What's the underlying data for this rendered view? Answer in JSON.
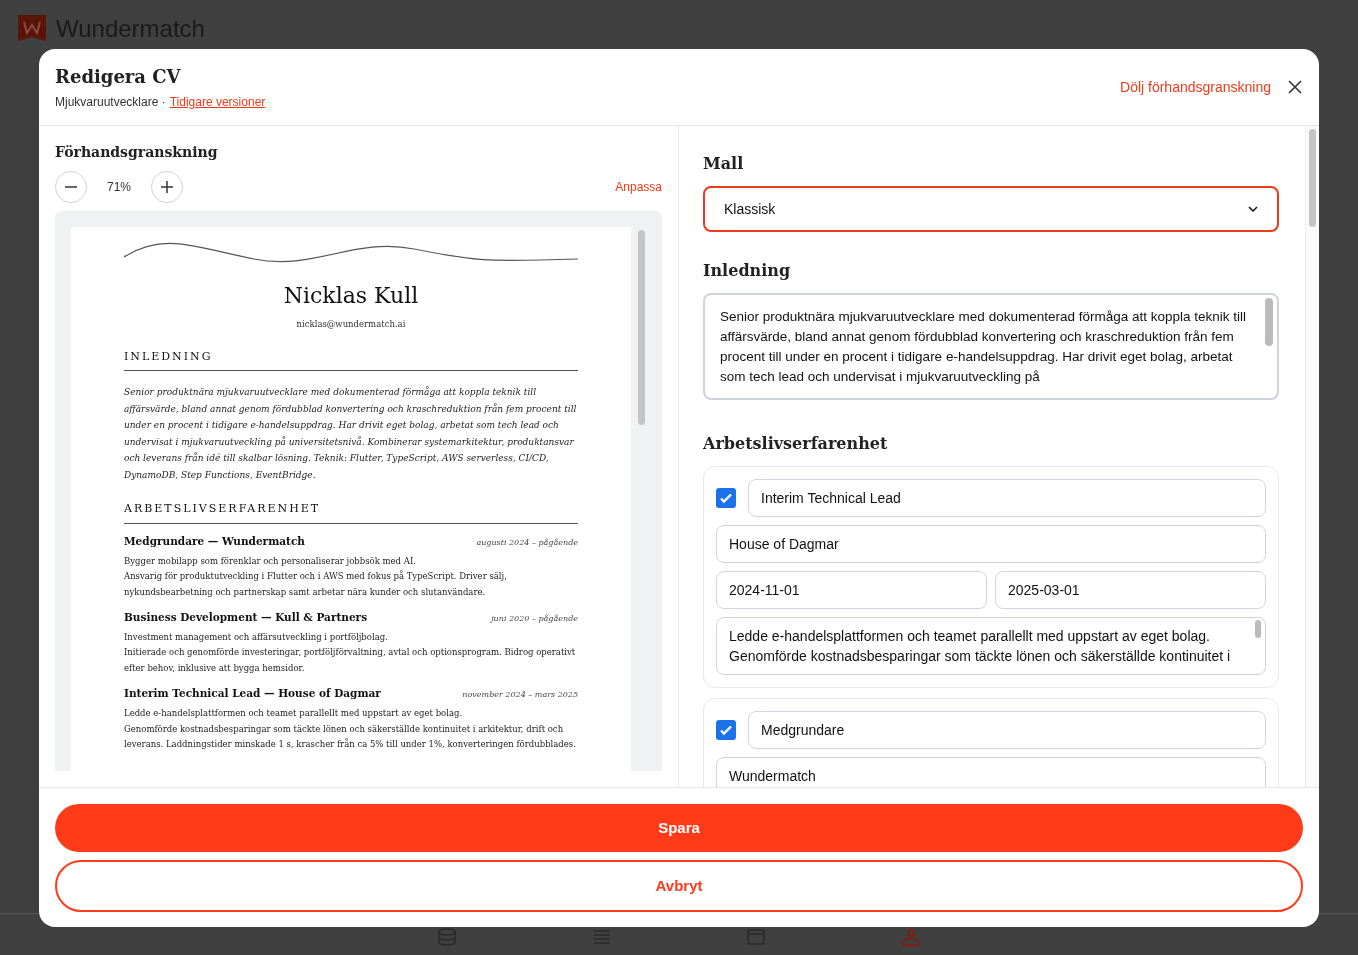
{
  "app": {
    "brand": "Wundermatch"
  },
  "nav_items": [
    {
      "selected": false
    },
    {
      "selected": false
    },
    {
      "selected": false
    },
    {
      "selected": true
    }
  ],
  "dialog": {
    "title": "Redigera CV",
    "subtitle": "Mjukvaruutvecklare ·",
    "versions_link": "Tidigare versioner",
    "hide_preview": "Dölj förhandsgranskning"
  },
  "preview": {
    "heading": "Förhandsgranskning",
    "zoom": "71%",
    "fit": "Anpassa",
    "document": {
      "name": "Nicklas Kull",
      "email": "nicklas@wundermatch.ai",
      "intro_heading": "INLEDNING",
      "intro": "Senior produktnära mjukvaruutvecklare med dokumenterad förmåga att koppla teknik till affärsvärde, bland annat genom fördubblad konvertering och kraschreduktion från fem procent till under en procent i tidigare e-handelsuppdrag. Har drivit eget bolag, arbetat som tech lead och undervisat i mjukvaruutveckling på universitetsnivå. Kombinerar systemarkitektur, produktansvar och leverans från idé till skalbar lösning. Teknik: Flutter, TypeScript, AWS serverless, CI/CD, DynamoDB, Step Functions, EventBridge.",
      "experience_heading": "ARBETSLIVSERFARENHET",
      "entries": [
        {
          "title": "Medgrundare — Wundermatch",
          "dates": "augusti 2024 – pågående",
          "lines": [
            "Bygger mobilapp som förenklar och personaliserar jobbsök med AI.",
            "Ansvarig för produktutveckling i Flutter och i AWS med fokus på TypeScript. Driver sälj, nykundsbearbetning och partnerskap samt arbetar nära kunder och slutanvändare."
          ]
        },
        {
          "title": "Business Development — Kull & Partners",
          "dates": "juni 2020 – pågående",
          "lines": [
            "Investment management och affärsutveckling i portföljbolag.",
            "Initierade och genomförde investeringar, portföljförvaltning, avtal och optionsprogram. Bidrog operativt efter behov, inklusive att bygga hemsidor."
          ]
        },
        {
          "title": "Interim Technical Lead — House of Dagmar",
          "dates": "november 2024 – mars 2025",
          "lines": [
            "Ledde e-handelsplattformen och teamet parallellt med uppstart av eget bolag.",
            "Genomförde kostnadsbesparingar som täckte lönen och säkerställde kontinuitet i arkitektur, drift och leverans. Laddningstider minskade 1 s, krascher från ca 5% till under 1%, konverteringen fördubblades."
          ]
        }
      ]
    }
  },
  "form": {
    "template_label": "Mall",
    "template": "Klassisk",
    "intro_label": "Inledning",
    "intro": "Senior produktnära mjukvaruutvecklare med dokumenterad förmåga att koppla teknik till affärsvärde, bland annat genom fördubblad konvertering och kraschreduktion från fem procent till under en procent i tidigare e-handelsuppdrag. Har drivit eget bolag, arbetat som tech lead och undervisat i mjukvaruutveckling på",
    "experience_label": "Arbetslivserfarenhet",
    "entries": [
      {
        "checked": true,
        "title": "Interim Technical Lead",
        "company": "House of Dagmar",
        "start": "2024-11-01",
        "end": "2025-03-01",
        "description": "Ledde e-handelsplattformen och teamet parallellt med uppstart av eget bolag. Genomförde kostnadsbesparingar som täckte lönen och säkerställde kontinuitet i"
      },
      {
        "checked": true,
        "title": "Medgrundare",
        "company": "Wundermatch"
      }
    ]
  },
  "footer": {
    "save": "Spara",
    "cancel": "Avbryt"
  }
}
